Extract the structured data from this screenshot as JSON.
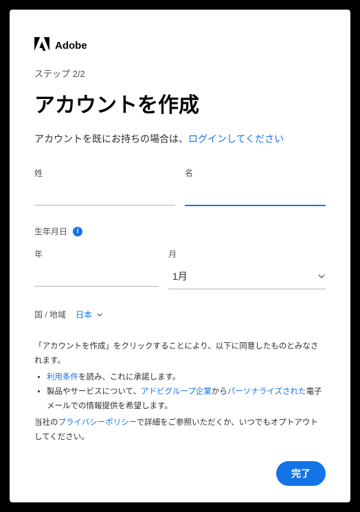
{
  "brand": {
    "name": "Adobe"
  },
  "step": "ステップ 2/2",
  "title": "アカウントを作成",
  "existing_account": {
    "prefix": "アカウントを既にお持ちの場合は、",
    "link": "ログインしてください"
  },
  "fields": {
    "last_name_label": "姓",
    "first_name_label": "名",
    "dob_label": "生年月日",
    "year_label": "年",
    "month_label": "月",
    "month_value": "1月",
    "region_label": "国 / 地域",
    "region_value": "日本"
  },
  "legal": {
    "intro": "「アカウントを作成」をクリックすることにより、以下に同意したものとみなされます。",
    "bullets": [
      {
        "link1": "利用条件",
        "text": "を読み、これに承諾します。"
      },
      {
        "pre": "製品やサービスについて、",
        "link1": "アドビグループ企業",
        "mid": "から",
        "link2": "パーソナライズされた",
        "text": "電子メールでの情報提供を希望します。"
      }
    ],
    "footer_pre": "当社の",
    "footer_link": "プライバシーポリシー",
    "footer_post": "で詳細をご参照いただくか、いつでもオプトアウトしてください。"
  },
  "buttons": {
    "done": "完了"
  }
}
